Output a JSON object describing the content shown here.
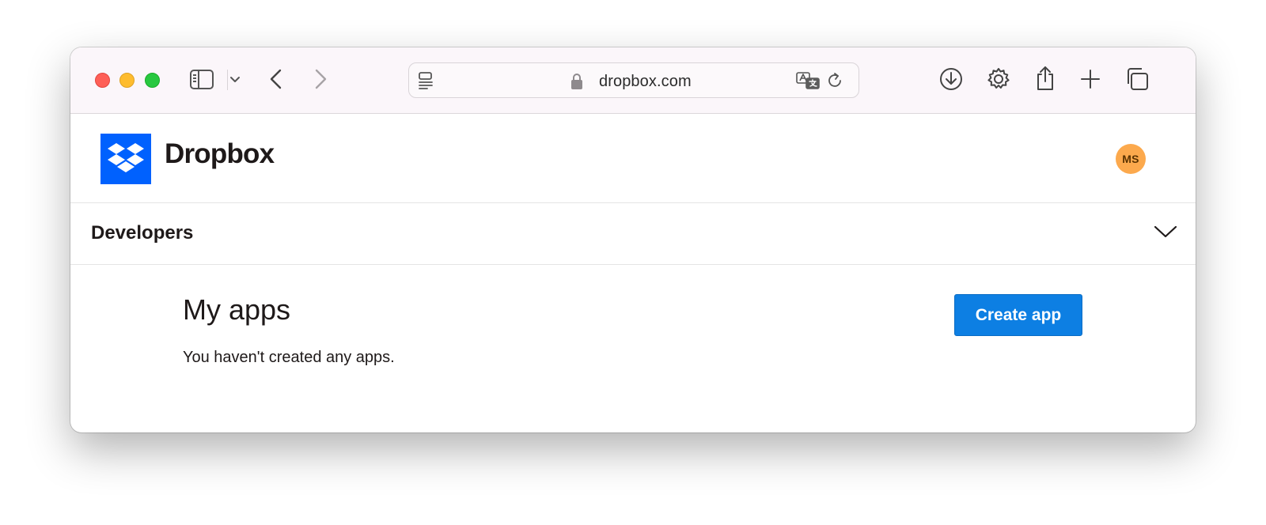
{
  "browser": {
    "url": "dropbox.com",
    "traffic_lights": {
      "close": "#fe5f57",
      "minimize": "#febc2e",
      "zoom": "#28c840"
    }
  },
  "site": {
    "brand": "Dropbox",
    "brand_color": "#0061fe",
    "avatar_initials": "MS",
    "avatar_color": "#fca94d"
  },
  "nav": {
    "section_title": "Developers"
  },
  "main": {
    "title": "My apps",
    "empty_message": "You haven't created any apps.",
    "create_button_label": "Create app",
    "button_color": "#0d7fe3"
  },
  "icons": [
    "sidebar-icon",
    "chevron-down-icon",
    "back-icon",
    "forward-icon",
    "reader-icon",
    "lock-icon",
    "translate-icon",
    "reload-icon",
    "download-icon",
    "gear-icon",
    "share-icon",
    "plus-icon",
    "tabs-icon"
  ]
}
